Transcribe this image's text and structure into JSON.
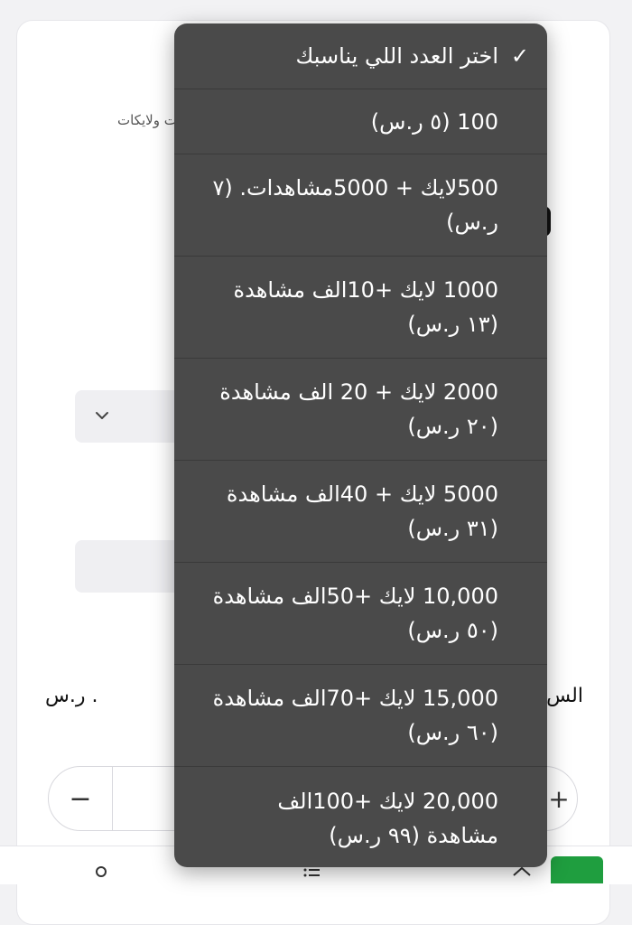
{
  "background": {
    "field_label": "ات ولايكات",
    "price_text": ". ر.س",
    "price_label_right": "الس",
    "stepper": {
      "minus": "−",
      "plus": "+"
    }
  },
  "menu": {
    "items": [
      {
        "label": "اختر العدد اللي يناسبك",
        "selected": true
      },
      {
        "label": "100 (٥ ر.س)"
      },
      {
        "label": "500لايك + 5000مشاهدات. (٧ ر.س)"
      },
      {
        "label": "1000 لايك +10الف مشاهدة (١٣ ر.س)"
      },
      {
        "label": "2000 لايك + 20 الف مشاهدة (٢٠ ر.س)"
      },
      {
        "label": "5000 لايك + 40الف مشاهدة (٣١ ر.س)"
      },
      {
        "label": "10,000 لايك +50الف مشاهدة (٥٠ ر.س)"
      },
      {
        "label": "15,000 لايك +70الف مشاهدة (٦٠ ر.س)"
      },
      {
        "label": "20,000 لايك +100الف مشاهدة (٩٩ ر.س)"
      }
    ],
    "check_icon": "✓"
  },
  "colors": {
    "menu_bg": "#4a4a4a",
    "menu_text": "#ffffff",
    "accent_green": "#1f9e3f"
  }
}
